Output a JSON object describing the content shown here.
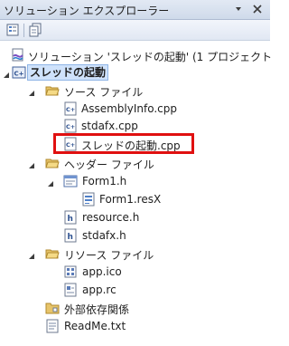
{
  "window": {
    "title": "ソリューション エクスプローラー"
  },
  "toolbar": {
    "buttons": [
      {
        "icon": "properties-icon"
      },
      {
        "icon": "show-all-files-icon"
      }
    ]
  },
  "tree": {
    "solution": "ソリューション 'スレッドの起動' (1 プロジェクト",
    "project": "スレッドの起動",
    "source_folder": "ソース ファイル",
    "assemblyinfo": "AssemblyInfo.cpp",
    "stdafx_cpp": "stdafx.cpp",
    "main_cpp": "スレッドの起動.cpp",
    "header_folder": "ヘッダー ファイル",
    "form1_h": "Form1.h",
    "form1_resx": "Form1.resX",
    "resource_h": "resource.h",
    "stdafx_h": "stdafx.h",
    "resource_folder": "リソース ファイル",
    "app_ico": "app.ico",
    "app_rc": "app.rc",
    "external_deps": "外部依存関係",
    "readme": "ReadMe.txt"
  },
  "colors": {
    "highlight": "#e01010",
    "selection": "#cfe2fb"
  }
}
